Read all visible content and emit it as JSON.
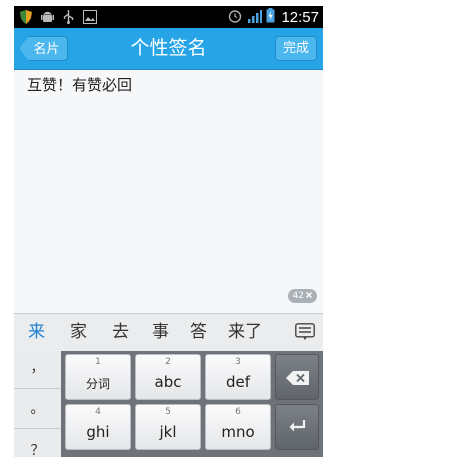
{
  "status_bar": {
    "time": "12:57",
    "left_icons": [
      "shield-icon",
      "android-icon",
      "usb-icon",
      "image-icon"
    ],
    "right_icons": [
      "alarm-icon",
      "signal-icon",
      "battery-charging-icon"
    ]
  },
  "nav": {
    "back_label": "名片",
    "title": "个性签名",
    "done_label": "完成"
  },
  "editor": {
    "text": "互赞！有赞必回",
    "remaining": "42"
  },
  "candidates": [
    {
      "text": "来",
      "selected": true
    },
    {
      "text": "家",
      "selected": false
    },
    {
      "text": "去",
      "selected": false
    },
    {
      "text": "事",
      "selected": false
    },
    {
      "text": "答",
      "selected": false
    },
    {
      "text": "来了",
      "selected": false
    }
  ],
  "keyboard": {
    "symbols": [
      "，",
      "。",
      "？"
    ],
    "row1": [
      {
        "num": "1",
        "label": "分词"
      },
      {
        "num": "2",
        "label": "abc"
      },
      {
        "num": "3",
        "label": "def"
      }
    ],
    "row2": [
      {
        "num": "4",
        "label": "ghi"
      },
      {
        "num": "5",
        "label": "jkl"
      },
      {
        "num": "6",
        "label": "mno"
      }
    ]
  },
  "colors": {
    "nav_bg": "#26a4e6",
    "selected_candidate": "#1f7fd0"
  }
}
